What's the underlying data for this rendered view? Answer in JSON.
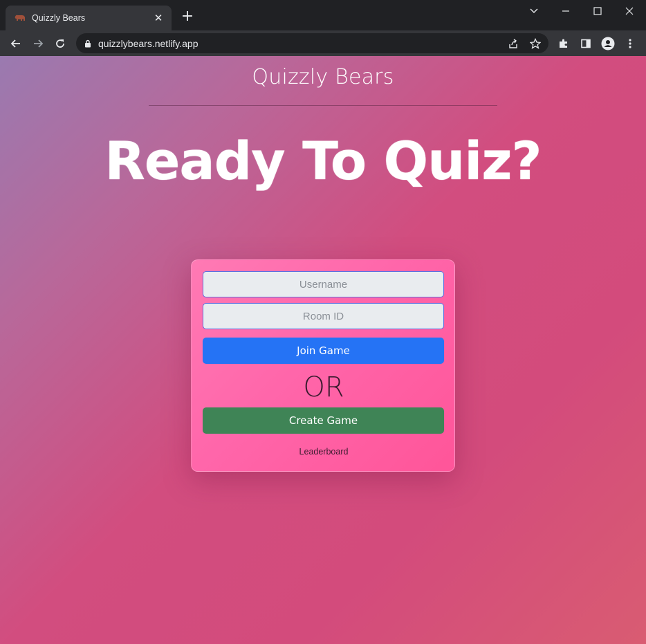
{
  "browser": {
    "tab_title": "Quizzly Bears",
    "new_tab_glyph": "+",
    "close_glyph": "✕",
    "url": "quizzlybears.netlify.app",
    "icons": [
      "bear-favicon-icon",
      "back-icon",
      "forward-icon",
      "reload-icon",
      "lock-icon",
      "share-icon",
      "star-icon",
      "extensions-icon",
      "side-panel-icon",
      "profile-icon",
      "more-icon",
      "tab-search-icon",
      "minimize-icon",
      "maximize-icon",
      "window-close-icon"
    ]
  },
  "page": {
    "site_title": "Quizzly Bears",
    "headline": "Ready To Quiz?",
    "form": {
      "username_placeholder": "Username",
      "room_placeholder": "Room ID",
      "join_label": "Join Game",
      "or_label": "OR",
      "create_label": "Create Game",
      "leaderboard_label": "Leaderboard"
    }
  },
  "colors": {
    "join_button": "#2573f5",
    "create_button": "#3f8456",
    "card": "#ff66aa",
    "chrome_dark": "#202124",
    "chrome_toolbar": "#35363a"
  }
}
